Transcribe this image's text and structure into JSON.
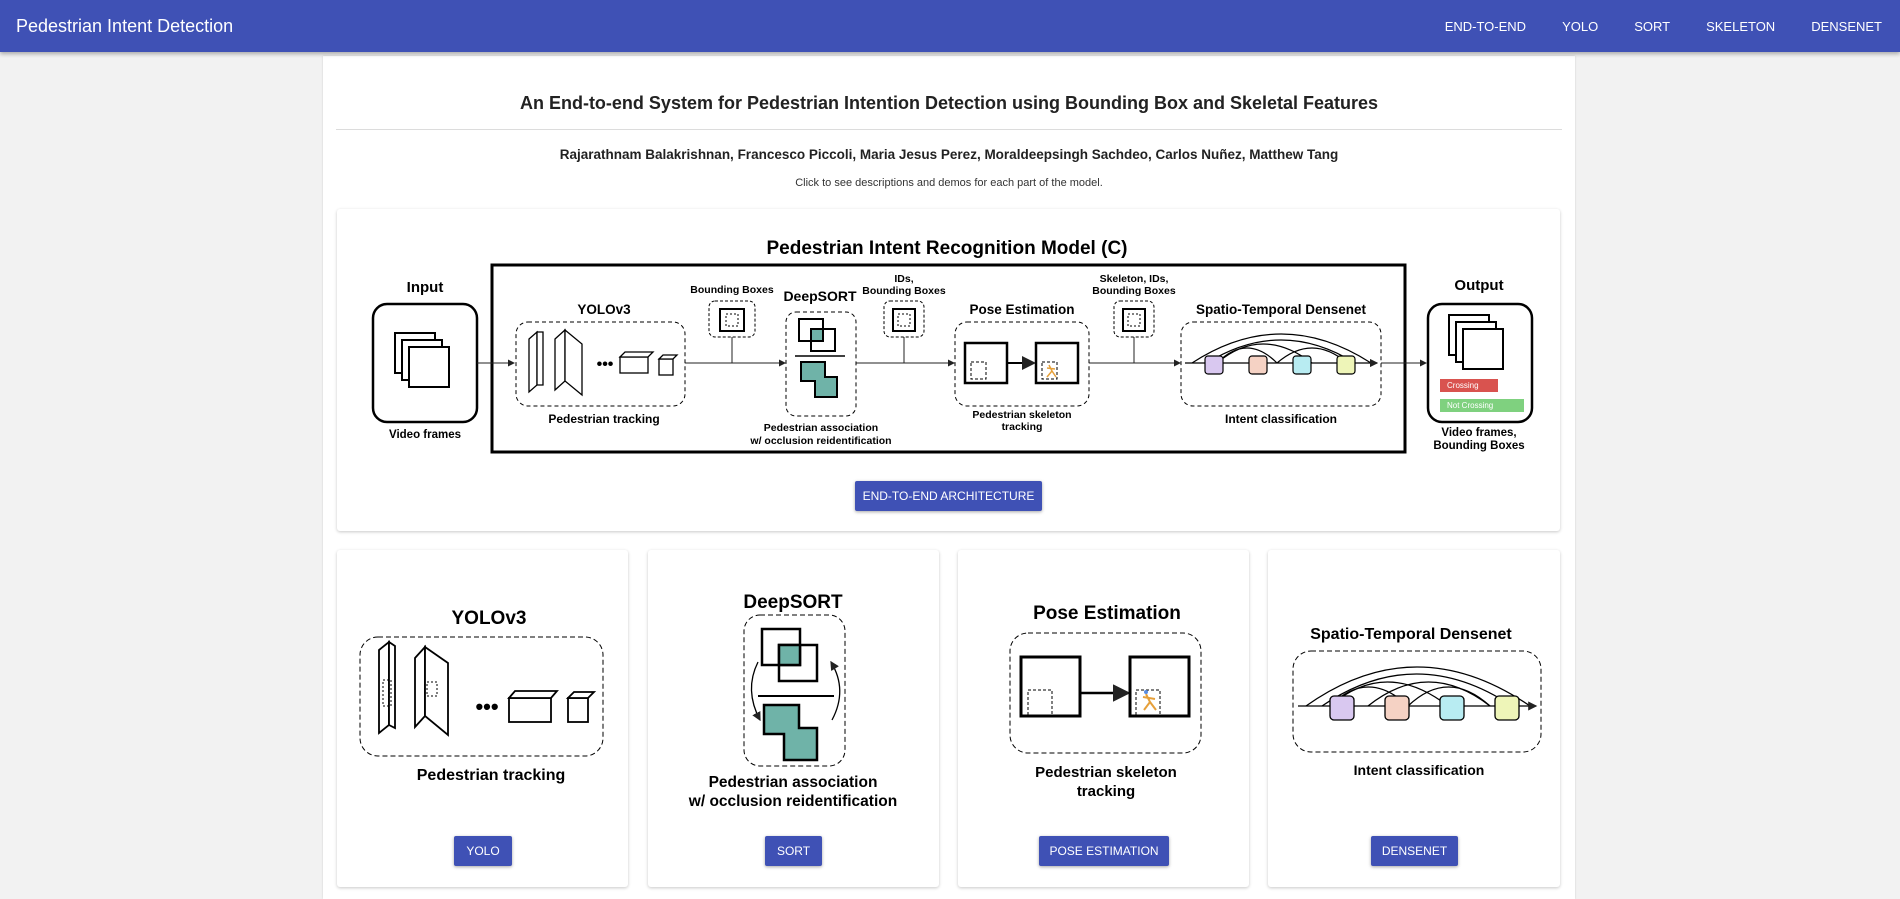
{
  "appbar": {
    "title": "Pedestrian Intent Detection",
    "nav": [
      "END-TO-END",
      "YOLO",
      "SORT",
      "SKELETON",
      "DENSENET"
    ]
  },
  "header": {
    "title": "An End-to-end System for Pedestrian Intention Detection using Bounding Box and Skeletal Features",
    "authors": "Rajarathnam Balakrishnan, Francesco Piccoli, Maria Jesus Perez, Moraldeepsingh Sachdeo, Carlos Nuñez, Matthew Tang",
    "hint": "Click to see descriptions and demos for each part of the model."
  },
  "diagram": {
    "title": "Pedestrian Intent Recognition Model (C)",
    "input_label": "Input",
    "input_caption": "Video frames",
    "yolo_label": "YOLOv3",
    "yolo_caption": "Pedestrian tracking",
    "bbox_label": "Bounding Boxes",
    "deepsort_label": "DeepSORT",
    "deepsort_caption_1": "Pedestrian association",
    "deepsort_caption_2": "w/ occlusion reidentification",
    "ids_label_1": "IDs,",
    "ids_label_2": "Bounding Boxes",
    "pose_label": "Pose Estimation",
    "pose_caption_1": "Pedestrian skeleton",
    "pose_caption_2": "tracking",
    "skel_label_1": "Skeleton, IDs,",
    "skel_label_2": "Bounding Boxes",
    "dense_label": "Spatio-Temporal Densenet",
    "dense_caption": "Intent classification",
    "output_label": "Output",
    "output_caption_1": "Video frames,",
    "output_caption_2": "Bounding Boxes",
    "crossing_label": "Crossing",
    "not_crossing_label": "Not Crossing",
    "crossing_color": "#d9534f",
    "not_crossing_color": "#7fd17f",
    "teal_color": "#6fb3a8",
    "button": "END-TO-END ARCHITECTURE"
  },
  "cards": [
    {
      "title": "YOLOv3",
      "caption_1": "Pedestrian tracking",
      "caption_2": "",
      "button": "YOLO"
    },
    {
      "title": "DeepSORT",
      "caption_1": "Pedestrian association",
      "caption_2": "w/ occlusion reidentification",
      "button": "SORT"
    },
    {
      "title": "Pose Estimation",
      "caption_1": "Pedestrian skeleton",
      "caption_2": "tracking",
      "button": "POSE ESTIMATION"
    },
    {
      "title": "Spatio-Temporal Densenet",
      "caption_1": "Intent classification",
      "caption_2": "",
      "button": "DENSENET"
    }
  ],
  "colors": {
    "primary": "#3f51b5",
    "cube_purple": "#d9c8f0",
    "cube_peach": "#f5d2c4",
    "cube_cyan": "#b8ecf2",
    "cube_lime": "#eef5b8"
  }
}
